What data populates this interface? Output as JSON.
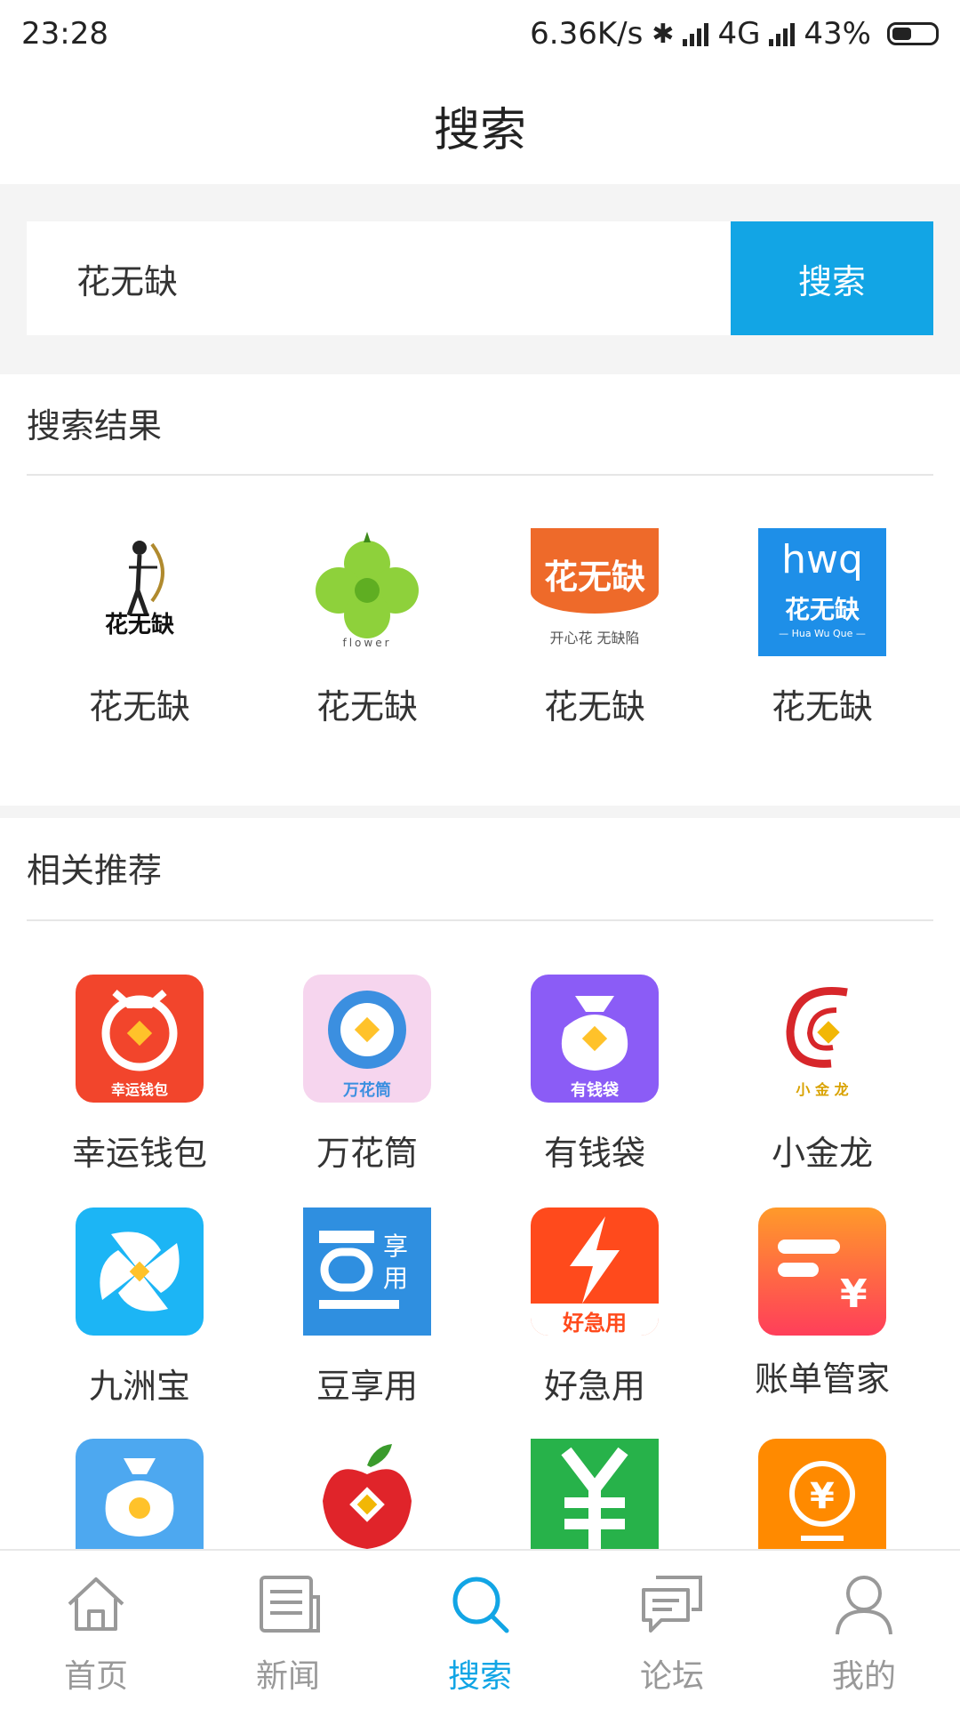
{
  "status_bar": {
    "time": "23:28",
    "net_speed": "6.36K/s",
    "network": "4G",
    "battery": "43%"
  },
  "header": {
    "title": "搜索"
  },
  "search": {
    "query": "花无缺",
    "button_label": "搜索"
  },
  "results": {
    "title": "搜索结果",
    "items": [
      {
        "label": "花无缺",
        "icon": "archer-logo-icon",
        "logo_text": "花无缺"
      },
      {
        "label": "花无缺",
        "icon": "clover-flower-icon",
        "logo_text": "flower"
      },
      {
        "label": "花无缺",
        "icon": "orange-logo-icon",
        "logo_text": "花无缺",
        "logo_sub": "开心花 无缺陷"
      },
      {
        "label": "花无缺",
        "icon": "hwq-blue-icon",
        "logo_text": "花无缺",
        "logo_top": "hwq",
        "logo_sub": "— Hua Wu Que —"
      }
    ]
  },
  "recommend": {
    "title": "相关推荐",
    "items": [
      {
        "label": "幸运钱包",
        "icon": "lucky-wallet-icon",
        "logo_text": "幸运钱包",
        "color": "#f2452c"
      },
      {
        "label": "万花筒",
        "icon": "kaleidoscope-icon",
        "logo_text": "万花筒",
        "color": "#f6d5ee"
      },
      {
        "label": "有钱袋",
        "icon": "money-bag-purple-icon",
        "logo_text": "有钱袋",
        "color": "#8b5cf6"
      },
      {
        "label": "小金龙",
        "icon": "golden-dragon-icon",
        "logo_text": "小 金 龙",
        "color": "#ffffff"
      },
      {
        "label": "九洲宝",
        "icon": "pinwheel-icon",
        "color": "#1cb5f5"
      },
      {
        "label": "豆享用",
        "icon": "dou-xiangyong-icon",
        "logo_text": "享用",
        "color": "#2f8fe0"
      },
      {
        "label": "好急用",
        "icon": "lightning-icon",
        "logo_text": "好急用",
        "color": "#ff4a1c"
      },
      {
        "label": "账单管家",
        "icon": "bill-manager-icon",
        "color": "#ff4d3a"
      },
      {
        "label": "",
        "icon": "money-bag-blue-icon",
        "color": "#4da8f0"
      },
      {
        "label": "",
        "icon": "red-apple-icon",
        "color": "#ffffff"
      },
      {
        "label": "",
        "icon": "yen-green-icon",
        "color": "#27b24a"
      },
      {
        "label": "",
        "icon": "yen-orange-icon",
        "color": "#ff8a00"
      }
    ]
  },
  "bottom_nav": {
    "items": [
      {
        "label": "首页",
        "icon": "home-icon"
      },
      {
        "label": "新闻",
        "icon": "news-icon"
      },
      {
        "label": "搜索",
        "icon": "search-icon",
        "active": true
      },
      {
        "label": "论坛",
        "icon": "forum-icon"
      },
      {
        "label": "我的",
        "icon": "profile-icon"
      }
    ]
  }
}
